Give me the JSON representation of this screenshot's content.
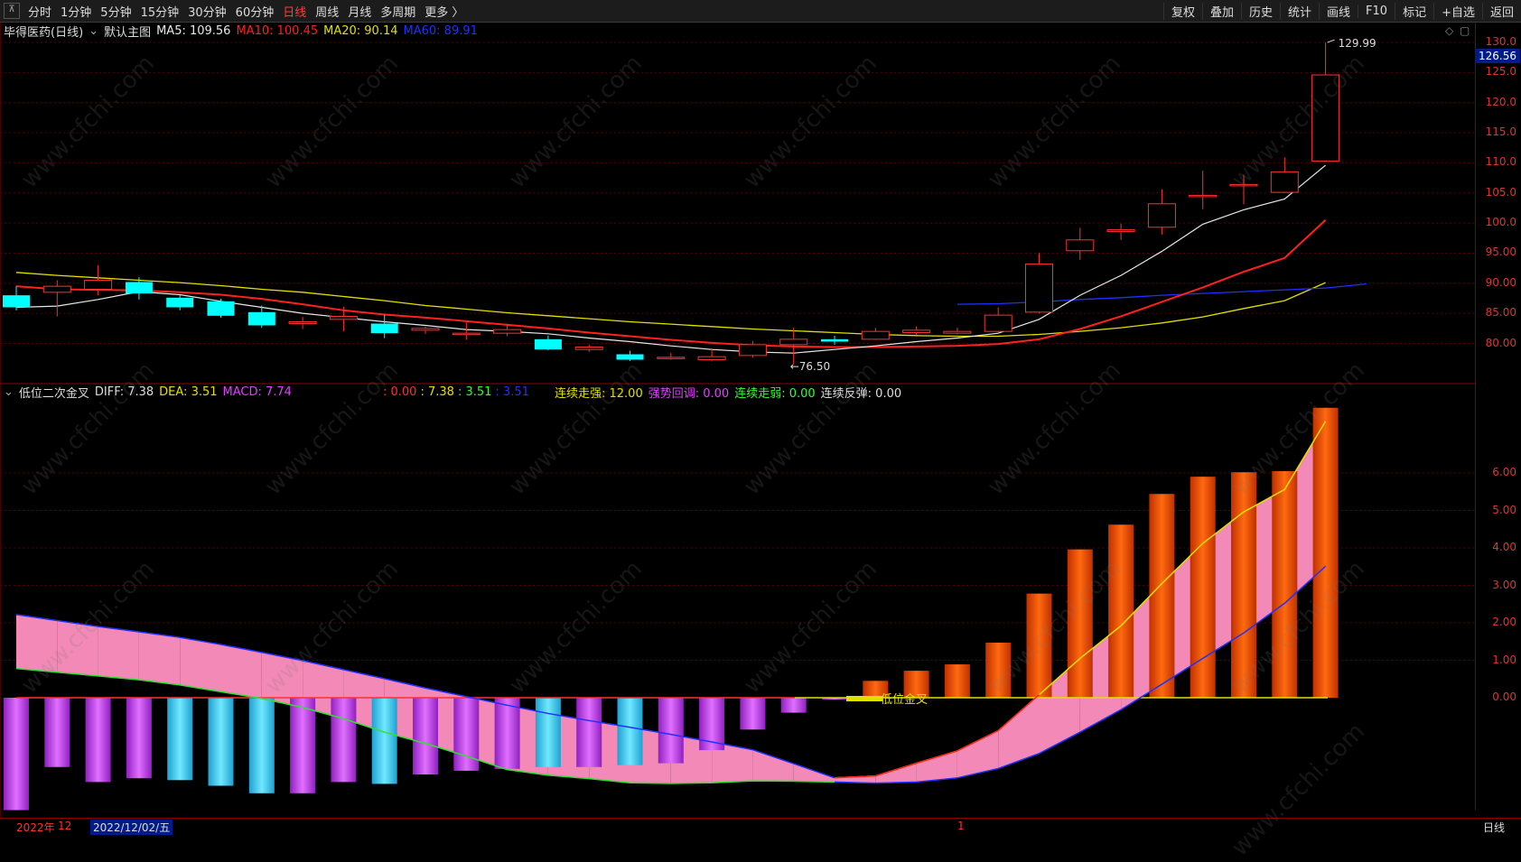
{
  "toolbar": {
    "periods": [
      "分时",
      "1分钟",
      "5分钟",
      "15分钟",
      "30分钟",
      "60分钟",
      "日线",
      "周线",
      "月线",
      "多周期",
      "更多 〉"
    ],
    "active_period": "日线",
    "actions": [
      "复权",
      "叠加",
      "历史",
      "统计",
      "画线",
      "F10",
      "标记",
      "+自选",
      "返回"
    ]
  },
  "main_legend": {
    "stock": "毕得医药(日线)",
    "template": "默认主图",
    "ma5": "MA5: 109.56",
    "ma10": "MA10: 100.45",
    "ma20": "MA20: 90.14",
    "ma60": "MA60: 89.91"
  },
  "sub_legend": {
    "indicator": "低位二次金叉",
    "diff": "DIFF: 7.38",
    "dea": "DEA: 3.51",
    "macd": "MACD: 7.74",
    "v1": ": 0.00",
    "v2": ": 7.38",
    "v3": ": 3.51",
    "v4": ": 3.51",
    "s1": "连续走强: 12.00",
    "s2": "强势回调: 0.00",
    "s3": "连续走弱: 0.00",
    "s4": "连续反弹: 0.00"
  },
  "price_axis": [
    "130.0",
    "125.0",
    "120.0",
    "115.0",
    "110.0",
    "105.0",
    "100.0",
    "95.00",
    "90.00",
    "85.00",
    "80.00"
  ],
  "current_price": "126.56",
  "annotations": {
    "high": "129.99",
    "low": "76.50",
    "gold_cross": "低位金叉"
  },
  "macd_axis": [
    "6.00",
    "5.00",
    "4.00",
    "3.00",
    "2.00",
    "1.00",
    "0.00"
  ],
  "bottom": {
    "year": "2022年",
    "month": "12",
    "date": "2022/12/02/五",
    "mark": "1",
    "period": "日线"
  },
  "watermark": "www.cfchi.com",
  "colors": {
    "up": "#ff3030",
    "down": "#00ffff",
    "ma5": "#e8e8e8",
    "ma10": "#ff2020",
    "ma20": "#e0e000",
    "ma60": "#2030ff"
  },
  "chart_data": [
    {
      "type": "candlestick",
      "ylim": [
        76,
        131
      ],
      "candles": [
        {
          "o": 88,
          "c": 86,
          "h": 89.5,
          "l": 85.5
        },
        {
          "o": 88.5,
          "c": 89.5,
          "h": 90.5,
          "l": 84.5
        },
        {
          "o": 89,
          "c": 90.5,
          "h": 93,
          "l": 88
        },
        {
          "o": 90.2,
          "c": 88.3,
          "h": 91,
          "l": 87.3
        },
        {
          "o": 87.6,
          "c": 86,
          "h": 88,
          "l": 85.5
        },
        {
          "o": 87,
          "c": 84.6,
          "h": 87.4,
          "l": 84.3
        },
        {
          "o": 85.2,
          "c": 83,
          "h": 86.3,
          "l": 82.6
        },
        {
          "o": 83.3,
          "c": 83.6,
          "h": 84.4,
          "l": 82.4
        },
        {
          "o": 84,
          "c": 84.5,
          "h": 86.1,
          "l": 82
        },
        {
          "o": 83.3,
          "c": 81.7,
          "h": 84.8,
          "l": 80.9
        },
        {
          "o": 82.2,
          "c": 82.5,
          "h": 82.8,
          "l": 81.6
        },
        {
          "o": 81.7,
          "c": 81.7,
          "h": 83.5,
          "l": 80.6
        },
        {
          "o": 81.7,
          "c": 82.3,
          "h": 83.3,
          "l": 81.2
        },
        {
          "o": 80.7,
          "c": 79,
          "h": 81.3,
          "l": 78.9
        },
        {
          "o": 79,
          "c": 79.4,
          "h": 79.8,
          "l": 78.6
        },
        {
          "o": 78.2,
          "c": 77.3,
          "h": 78.8,
          "l": 77.1
        },
        {
          "o": 77.7,
          "c": 77.7,
          "h": 78.4,
          "l": 77.3
        },
        {
          "o": 77.3,
          "c": 77.8,
          "h": 79.2,
          "l": 77
        },
        {
          "o": 78,
          "c": 79.8,
          "h": 80.4,
          "l": 77.6
        },
        {
          "o": 79.8,
          "c": 80.7,
          "h": 82.6,
          "l": 76.5
        },
        {
          "o": 80.7,
          "c": 80.3,
          "h": 81.3,
          "l": 79.8
        },
        {
          "o": 80.7,
          "c": 82,
          "h": 82.6,
          "l": 80.6
        },
        {
          "o": 81.8,
          "c": 82.2,
          "h": 82.8,
          "l": 81.5
        },
        {
          "o": 81.7,
          "c": 82,
          "h": 82.6,
          "l": 81.5
        },
        {
          "o": 82,
          "c": 84.7,
          "h": 86,
          "l": 81.7
        },
        {
          "o": 85.2,
          "c": 93.2,
          "h": 95,
          "l": 85
        },
        {
          "o": 95.4,
          "c": 97.2,
          "h": 99.2,
          "l": 93.9
        },
        {
          "o": 98.6,
          "c": 98.9,
          "h": 99.9,
          "l": 97.2
        },
        {
          "o": 99.3,
          "c": 103.2,
          "h": 105.6,
          "l": 98.1
        },
        {
          "o": 104.4,
          "c": 104.6,
          "h": 108.7,
          "l": 102.3
        },
        {
          "o": 106.4,
          "c": 106.4,
          "h": 108,
          "l": 103.1
        },
        {
          "o": 105.1,
          "c": 108.5,
          "h": 110.9,
          "l": 105
        },
        {
          "o": 110.3,
          "c": 124.6,
          "h": 129.99,
          "l": 110.3
        }
      ],
      "ma5": [
        86,
        86.2,
        87.3,
        88.6,
        88.1,
        87,
        86,
        85,
        84.3,
        83.6,
        83,
        82.3,
        82,
        81.6,
        80.9,
        80.3,
        79.6,
        79,
        78.6,
        78.4,
        79,
        79.6,
        80.3,
        80.9,
        81.7,
        84,
        88,
        91.3,
        95.3,
        99.8,
        102.2,
        104,
        109.6
      ],
      "ma10": [
        89.5,
        89,
        88.9,
        88.8,
        88.5,
        88.1,
        87.4,
        86.5,
        85.5,
        84.8,
        84.3,
        83.7,
        83.1,
        82.5,
        81.8,
        81.2,
        80.6,
        80.1,
        79.7,
        79.5,
        79.4,
        79.4,
        79.5,
        79.6,
        79.9,
        80.7,
        82.4,
        84.5,
        86.9,
        89.3,
        91.9,
        94.2,
        100.5
      ],
      "ma20": [
        91.8,
        91.3,
        90.9,
        90.5,
        90.1,
        89.6,
        89,
        88.5,
        87.8,
        87.1,
        86.3,
        85.7,
        85.1,
        84.6,
        84.1,
        83.6,
        83.2,
        82.8,
        82.4,
        82.1,
        81.8,
        81.5,
        81.3,
        81.2,
        81.2,
        81.5,
        82,
        82.6,
        83.4,
        84.4,
        85.8,
        87.1,
        90.1
      ],
      "ma60_start": 23,
      "ma60": [
        86.5,
        86.6,
        86.9,
        87.3,
        87.6,
        88,
        88.3,
        88.6,
        88.9,
        89.2,
        89.9
      ]
    },
    {
      "type": "bar",
      "title": "低位二次金叉",
      "macd": [
        -3,
        -1.85,
        -2.25,
        -2.15,
        -2.2,
        -2.35,
        -2.55,
        -2.55,
        -2.25,
        -2.3,
        -2.05,
        -1.95,
        -1.9,
        -1.85,
        -1.85,
        -1.8,
        -1.75,
        -1.4,
        -0.85,
        -0.4,
        -0.05,
        0.45,
        0.72,
        0.89,
        1.47,
        2.78,
        3.96,
        4.62,
        5.44,
        5.9,
        6.02,
        6.05,
        7.74
      ],
      "diff": [
        2.22,
        2.06,
        1.9,
        1.76,
        1.61,
        1.42,
        1.21,
        0.99,
        0.75,
        0.51,
        0.26,
        0.03,
        -0.2,
        -0.42,
        -0.61,
        -0.79,
        -0.98,
        -1.18,
        -1.39,
        -1.76,
        -2.14,
        -2.09,
        -1.75,
        -1.42,
        -0.88,
        0.08,
        1.05,
        1.92,
        3.05,
        4.12,
        4.96,
        5.56,
        7.38
      ],
      "dea": [
        0.78,
        0.68,
        0.58,
        0.48,
        0.34,
        0.16,
        -0.02,
        -0.26,
        -0.56,
        -0.92,
        -1.22,
        -1.56,
        -1.92,
        -2.07,
        -2.16,
        -2.27,
        -2.29,
        -2.27,
        -2.22,
        -2.23,
        -2.25,
        -2.28,
        -2.25,
        -2.14,
        -1.89,
        -1.49,
        -0.92,
        -0.32,
        0.36,
        1.05,
        1.73,
        2.52,
        3.51
      ],
      "ylim": [
        -3.1,
        7.9
      ]
    }
  ]
}
